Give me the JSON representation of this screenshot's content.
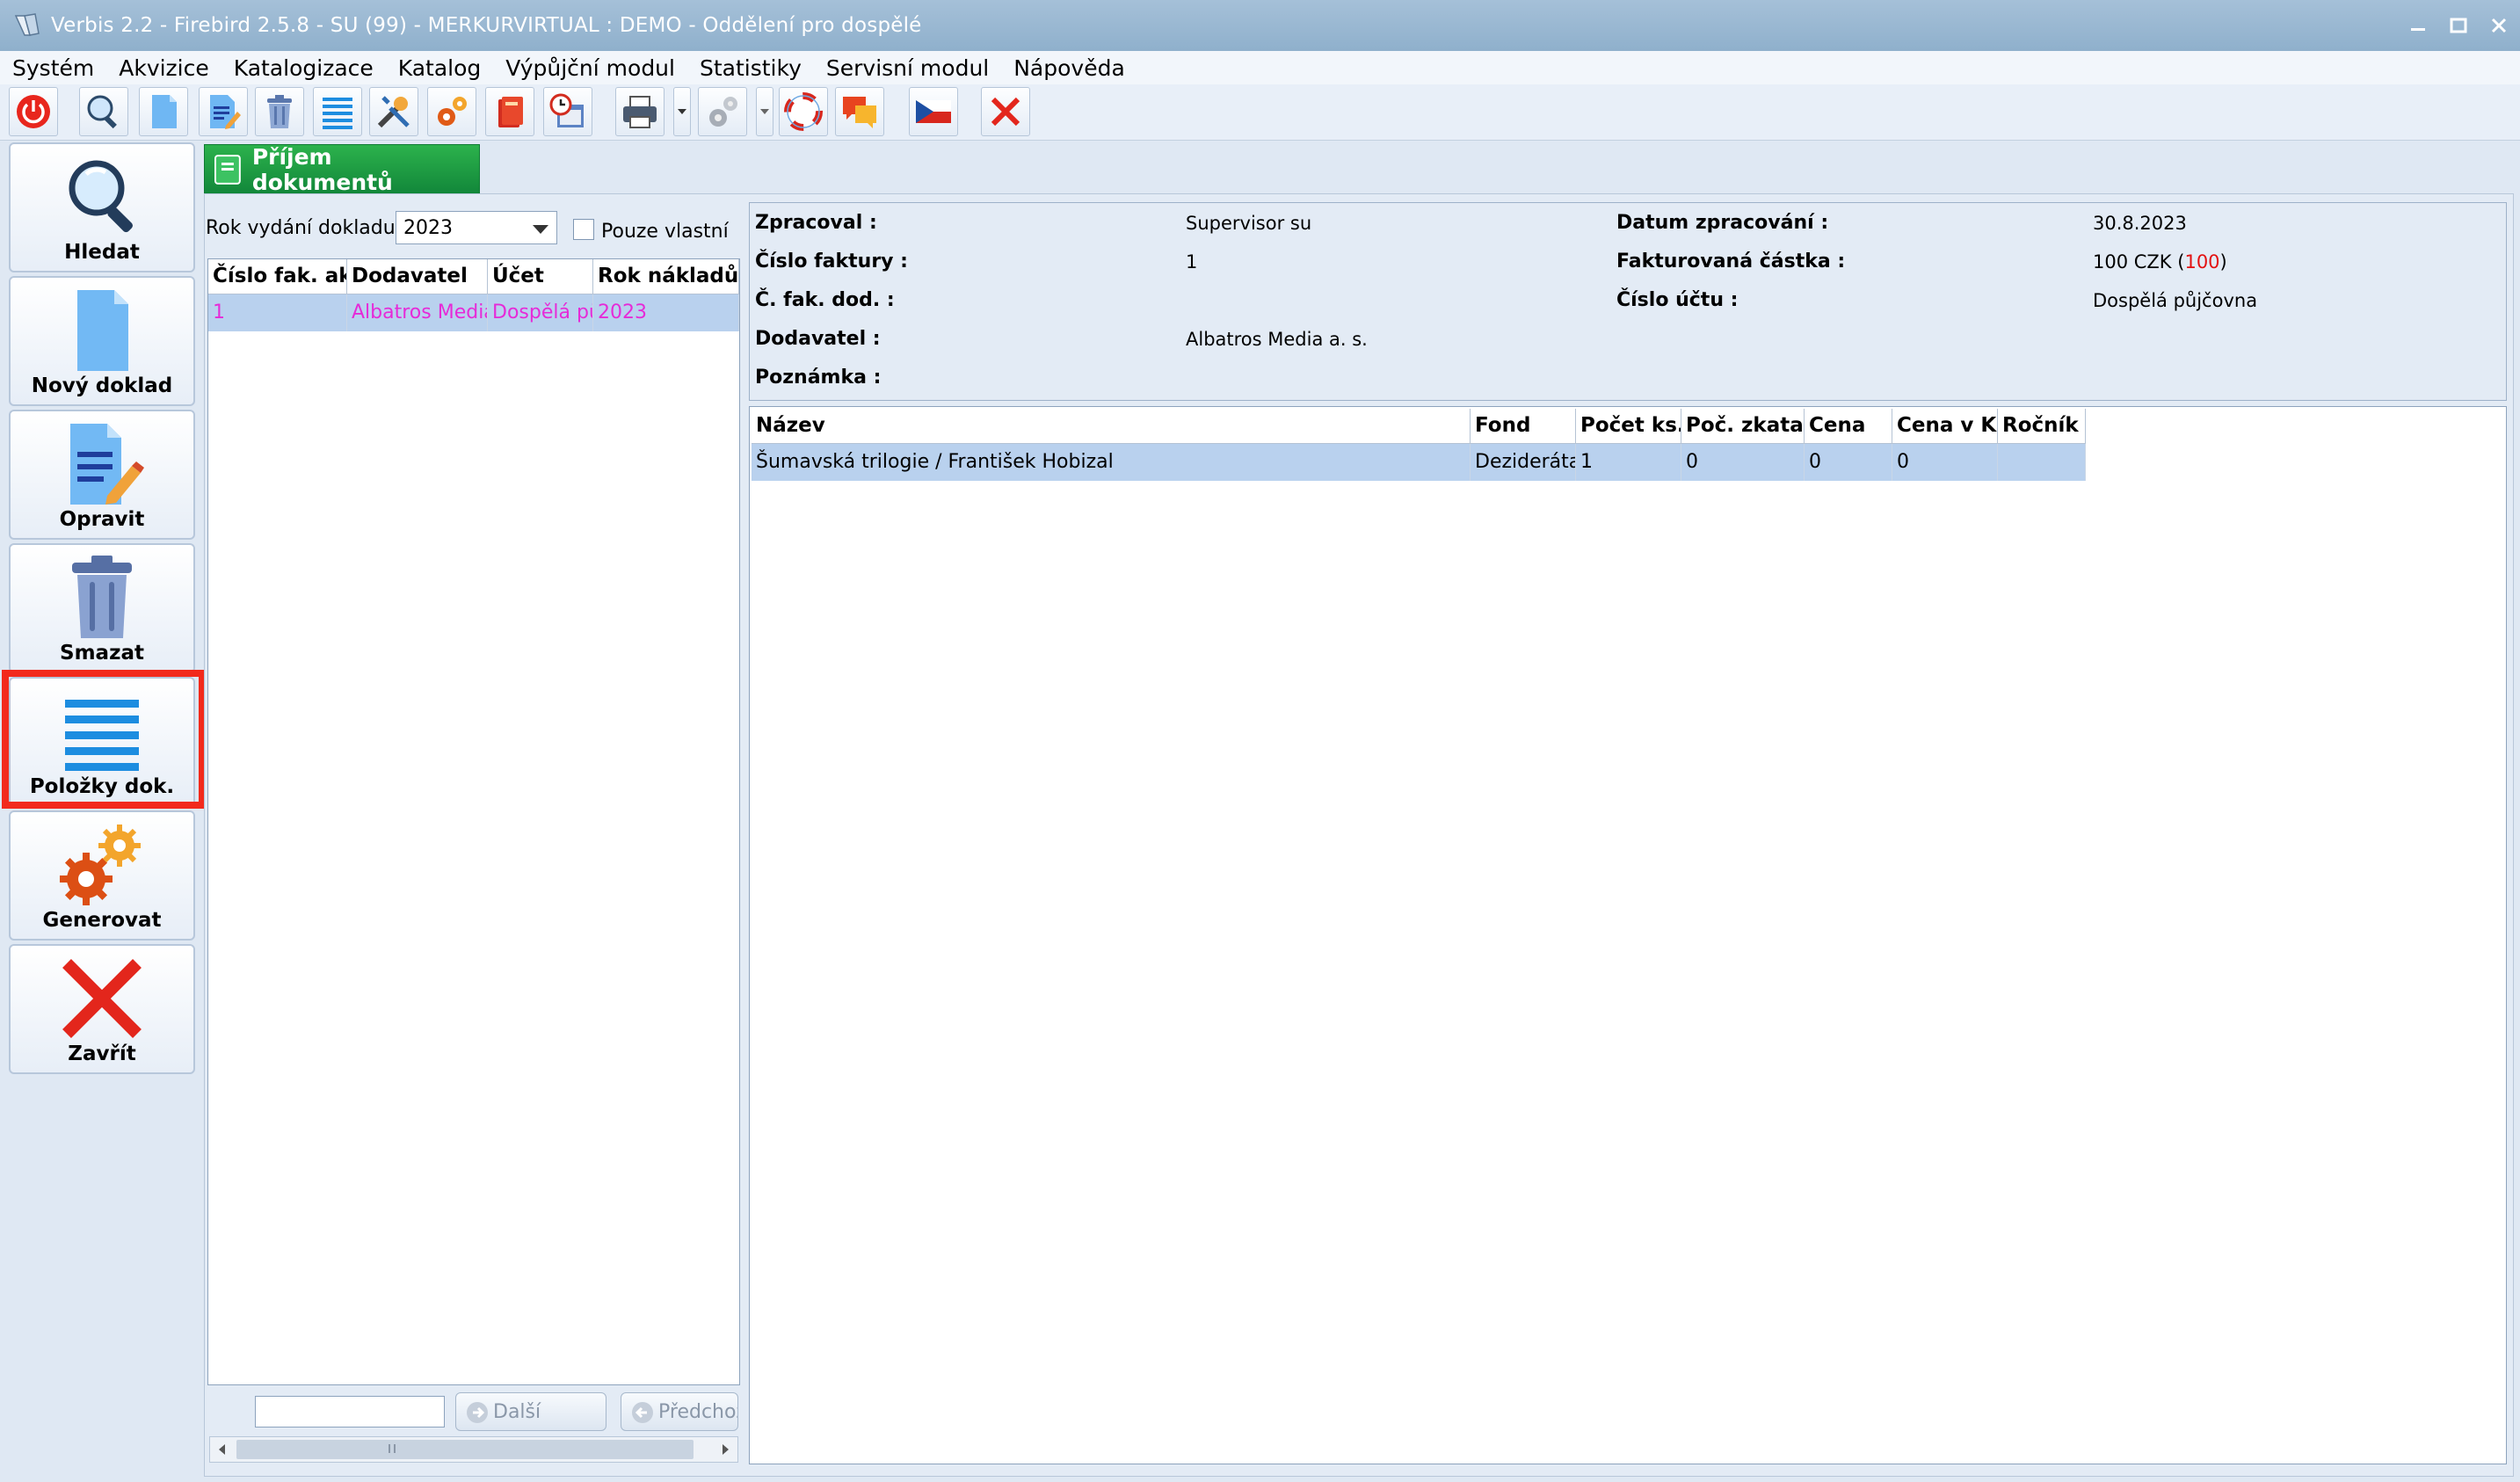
{
  "window": {
    "title": "Verbis 2.2 - Firebird 2.5.8 - SU (99) - MERKURVIRTUAL : DEMO - Oddělení pro dospělé"
  },
  "menu": [
    "Systém",
    "Akvizice",
    "Katalogizace",
    "Katalog",
    "Výpůjční modul",
    "Statistiky",
    "Servisní modul",
    "Nápověda"
  ],
  "sidebar": {
    "buttons": [
      {
        "label": "Hledat",
        "icon": "search-icon"
      },
      {
        "label": "Nový doklad",
        "icon": "new-document-icon"
      },
      {
        "label": "Opravit",
        "icon": "edit-document-icon"
      },
      {
        "label": "Smazat",
        "icon": "trash-icon"
      },
      {
        "label": "Položky dok.",
        "icon": "list-icon"
      },
      {
        "label": "Generovat",
        "icon": "gears-icon"
      },
      {
        "label": "Zavřít",
        "icon": "close-icon"
      }
    ]
  },
  "tab": {
    "label": "Příjem dokumentů"
  },
  "filter": {
    "year_label": "Rok vydání dokladu :",
    "year_value": "2023",
    "own_only_label": "Pouze vlastní"
  },
  "documents": {
    "columns": [
      "Číslo fak. akv",
      "Dodavatel",
      "Účet",
      "Rok nákladů"
    ],
    "rows": [
      {
        "number": "1",
        "supplier": "Albatros Media",
        "account": "Dospělá půjčovna",
        "year": "2023"
      }
    ]
  },
  "nav": {
    "next_label": "Další",
    "prev_label": "Předchozí"
  },
  "info": {
    "processed_by_label": "Zpracoval :",
    "processed_by": "Supervisor su",
    "date_label": "Datum zpracování :",
    "date": "30.8.2023",
    "invoice_label": "Číslo faktury :",
    "invoice": "1",
    "amount_label": "Fakturovaná částka :",
    "amount_main": "100 CZK (",
    "amount_red": "100",
    "amount_close": ")",
    "supplier_invoice_label": "Č. fak. dod. :",
    "account_label": "Číslo účtu :",
    "account": "Dospělá půjčovna",
    "supplier_label": "Dodavatel :",
    "supplier": "Albatros Media a. s.",
    "note_label": "Poznámka :"
  },
  "items": {
    "columns": [
      "Název",
      "Fond",
      "Počet ks.",
      "Poč. zkatal.",
      "Cena",
      "Cena v Kč",
      "Ročník"
    ],
    "rows": [
      {
        "title": "Šumavská trilogie / František Hobizal",
        "fund": "Dezideráta",
        "count": "1",
        "cataloged": "0",
        "price": "0",
        "price_czk": "0",
        "volume": ""
      }
    ]
  },
  "colors": {
    "accent": "#12873a",
    "highlight": "#f22a1c",
    "selected_row": "#b9d1ee"
  }
}
